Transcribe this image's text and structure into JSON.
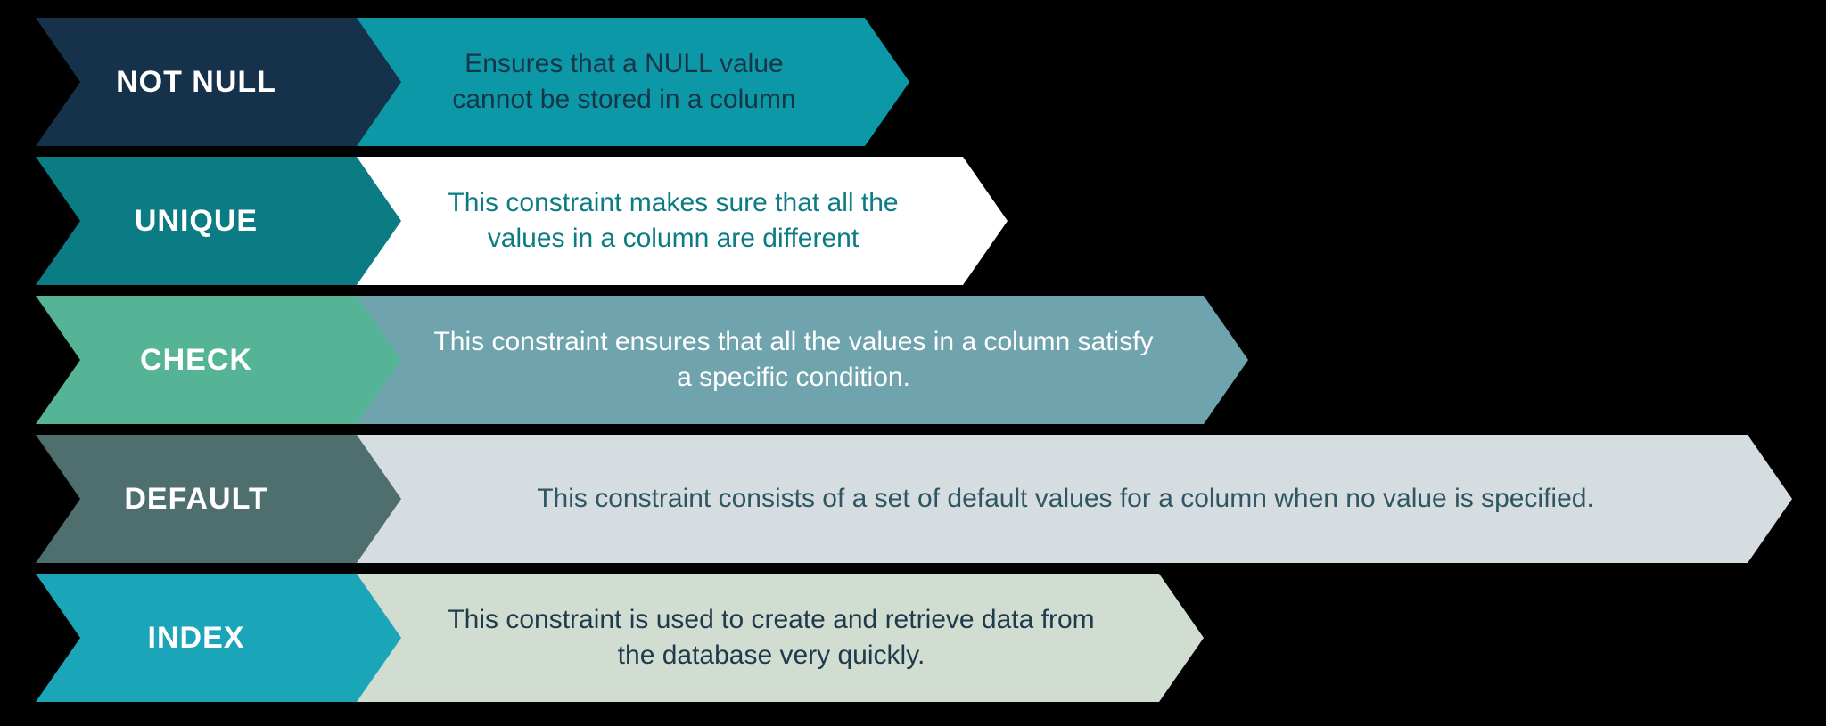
{
  "rows": [
    {
      "label": "NOT NULL",
      "desc": "Ensures that a NULL value cannot be stored in a column"
    },
    {
      "label": "UNIQUE",
      "desc": "This constraint makes sure that all the values in a column are different"
    },
    {
      "label": "CHECK",
      "desc": "This constraint ensures that all the values in a column satisfy a specific condition."
    },
    {
      "label": "DEFAULT",
      "desc": "This constraint consists of a set of default values for a column when no value is specified."
    },
    {
      "label": "INDEX",
      "desc": "This constraint is used to create and retrieve data from the database very quickly."
    }
  ]
}
